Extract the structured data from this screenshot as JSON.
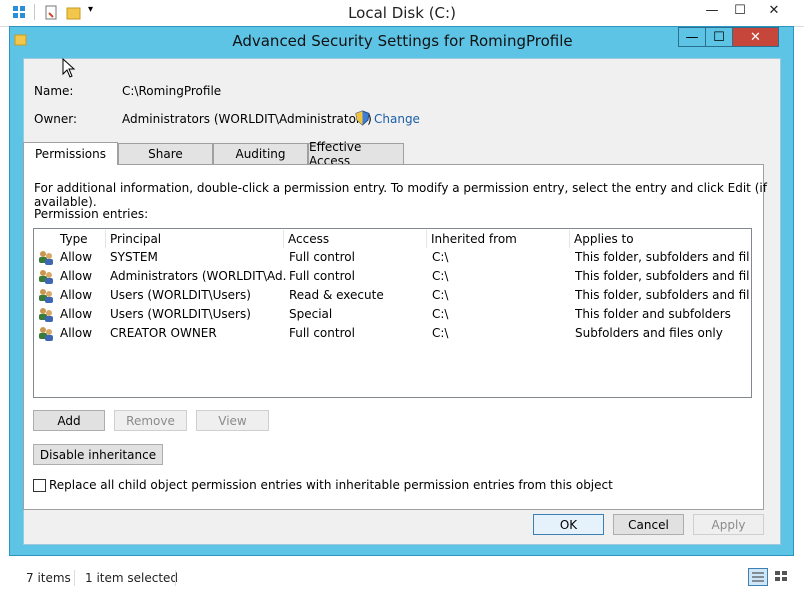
{
  "explorer": {
    "title": "Local Disk (C:)",
    "status": {
      "items": "7 items",
      "selected": "1 item selected"
    }
  },
  "dialog": {
    "title": "Advanced Security Settings for RomingProfile",
    "name_label": "Name:",
    "name_value": "C:\\RomingProfile",
    "owner_label": "Owner:",
    "owner_value": "Administrators (WORLDIT\\Administrators)",
    "change_link": "Change",
    "tabs": [
      {
        "label": "Permissions"
      },
      {
        "label": "Share"
      },
      {
        "label": "Auditing"
      },
      {
        "label": "Effective Access"
      }
    ],
    "info_text": "For additional information, double-click a permission entry. To modify a permission entry, select the entry and click Edit (if available).",
    "entries_label": "Permission entries:",
    "columns": [
      "Type",
      "Principal",
      "Access",
      "Inherited from",
      "Applies to"
    ],
    "rows": [
      {
        "type": "Allow",
        "principal": "SYSTEM",
        "access": "Full control",
        "inherited": "C:\\",
        "applies": "This folder, subfolders and files"
      },
      {
        "type": "Allow",
        "principal": "Administrators (WORLDIT\\Ad...",
        "access": "Full control",
        "inherited": "C:\\",
        "applies": "This folder, subfolders and files"
      },
      {
        "type": "Allow",
        "principal": "Users (WORLDIT\\Users)",
        "access": "Read & execute",
        "inherited": "C:\\",
        "applies": "This folder, subfolders and files"
      },
      {
        "type": "Allow",
        "principal": "Users (WORLDIT\\Users)",
        "access": "Special",
        "inherited": "C:\\",
        "applies": "This folder and subfolders"
      },
      {
        "type": "Allow",
        "principal": "CREATOR OWNER",
        "access": "Full control",
        "inherited": "C:\\",
        "applies": "Subfolders and files only"
      }
    ],
    "buttons": {
      "add": "Add",
      "remove": "Remove",
      "view": "View",
      "disable_inheritance": "Disable inheritance",
      "ok": "OK",
      "cancel": "Cancel",
      "apply": "Apply"
    },
    "replace_checkbox": "Replace all child object permission entries with inheritable permission entries from this object"
  },
  "colors": {
    "dialog_frame": "#5ec4e6",
    "close_button": "#c7463b",
    "link": "#1a5ea8"
  }
}
